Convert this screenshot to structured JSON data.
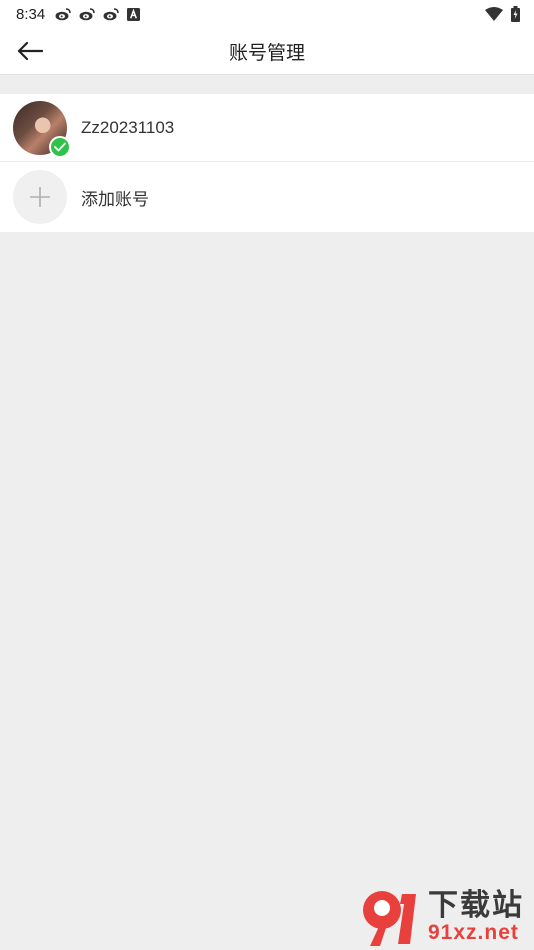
{
  "status_bar": {
    "time": "8:34",
    "left_icons": [
      "weibo-icon",
      "weibo-icon",
      "weibo-icon",
      "a-icon"
    ],
    "right_icons": [
      "wifi-icon",
      "battery-icon"
    ]
  },
  "app_bar": {
    "title": "账号管理",
    "back_icon": "arrow-left-icon"
  },
  "accounts": [
    {
      "name": "Zz20231103",
      "active": true
    }
  ],
  "add_account": {
    "label": "添加账号"
  },
  "watermark": {
    "brand_top": "下载站",
    "brand_bottom": "91xz.net",
    "logo_text": "91"
  },
  "colors": {
    "accent_check": "#2fc24a",
    "background": "#eeeeee",
    "watermark_red": "#e8403c"
  }
}
